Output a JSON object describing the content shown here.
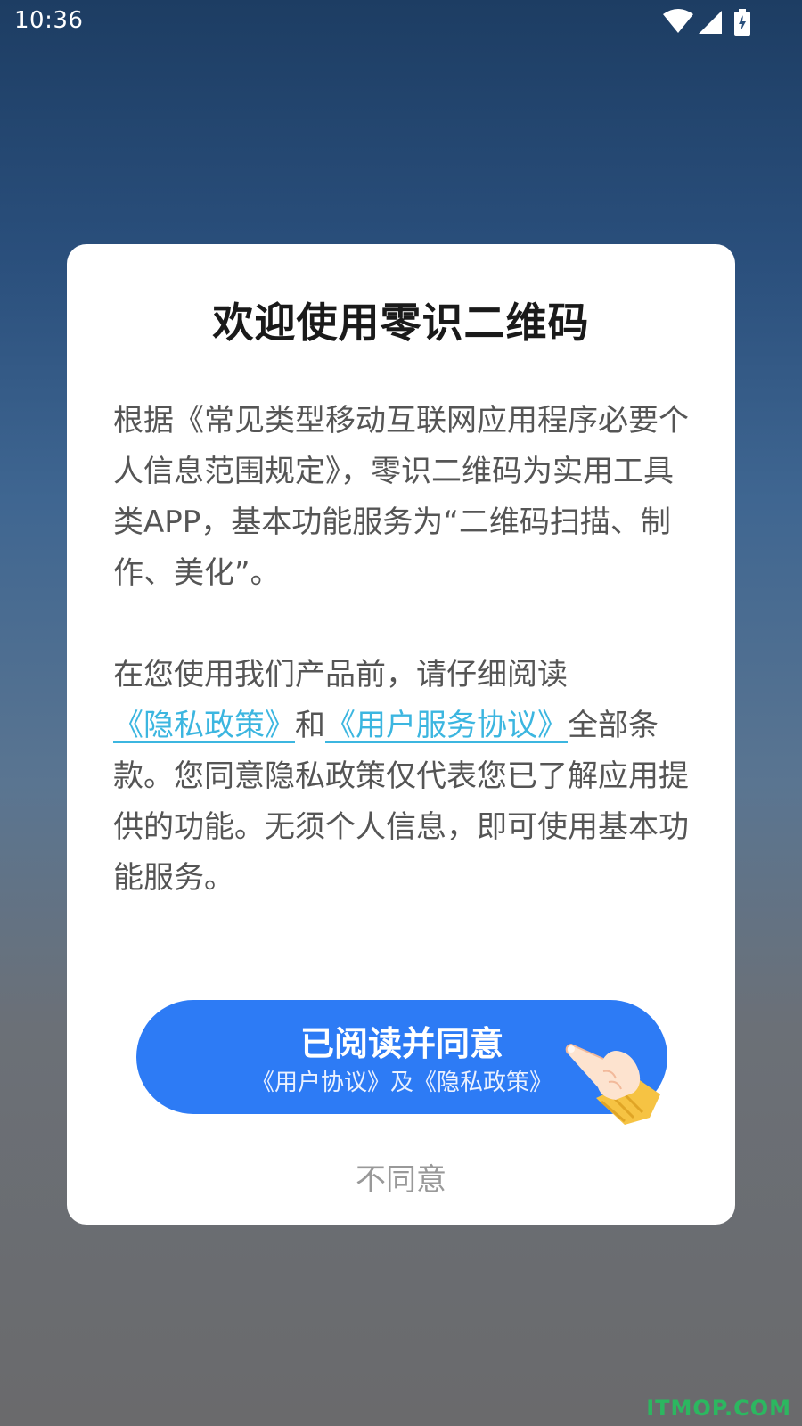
{
  "status_bar": {
    "time": "10:36",
    "icons": [
      "wifi-icon",
      "signal-icon",
      "battery-charging-icon"
    ]
  },
  "dialog": {
    "title": "欢迎使用零识二维码",
    "paragraph1": "根据《常见类型移动互联网应用程序必要个人信息范围规定》，零识二维码为实用工具类APP，基本功能服务为“二维码扫描、制作、美化”。",
    "paragraph2_before": "在您使用我们产品前，请仔细阅读",
    "privacy_link": "《隐私政策》",
    "connector": "和",
    "user_agreement_link": "《用户服务协议》",
    "paragraph2_after": "全部条款。您同意隐私政策仅代表您已了解应用提供的功能。无须个人信息，即可使用基本功能服务。",
    "agree_button": {
      "title": "已阅读并同意",
      "subtitle": "《用户协议》及《隐私政策》"
    },
    "disagree_label": "不同意"
  },
  "watermark": "ITMOP.COM",
  "colors": {
    "link": "#3cb6e0",
    "primary_button": "#2d7bf5",
    "title_text": "#1a1a1a",
    "body_text": "#555555",
    "muted_text": "#999999"
  }
}
